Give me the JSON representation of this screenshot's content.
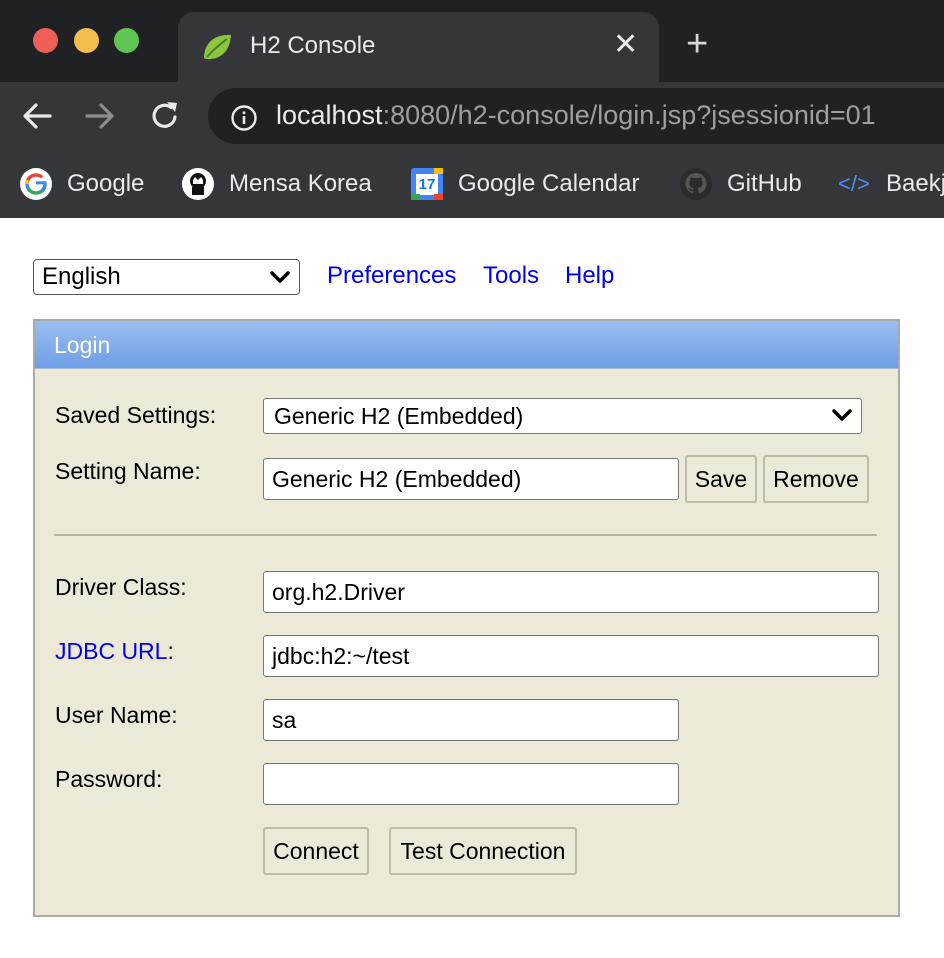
{
  "browser": {
    "tab_title": "H2 Console",
    "tab_close": "✕",
    "new_tab": "+",
    "url_host": "localhost",
    "url_rest": ":8080/h2-console/login.jsp?jsessionid=01",
    "bookmarks": [
      {
        "label": "Google"
      },
      {
        "label": "Mensa Korea"
      },
      {
        "label": "Google Calendar",
        "icon_text": "17"
      },
      {
        "label": "GitHub"
      },
      {
        "label": "Baekjoon",
        "icon_text": "</>"
      }
    ]
  },
  "top": {
    "language": "English",
    "links": [
      "Preferences",
      "Tools",
      "Help"
    ]
  },
  "login": {
    "title": "Login",
    "saved_settings_label": "Saved Settings:",
    "saved_settings_value": "Generic H2 (Embedded)",
    "setting_name_label": "Setting Name:",
    "setting_name_value": "Generic H2 (Embedded)",
    "save_button": "Save",
    "remove_button": "Remove",
    "driver_class_label": "Driver Class:",
    "driver_class_value": "org.h2.Driver",
    "jdbc_url_link": "JDBC URL",
    "jdbc_url_colon": ":",
    "jdbc_url_value": "jdbc:h2:~/test",
    "user_name_label": "User Name:",
    "user_name_value": "sa",
    "password_label": "Password:",
    "password_value": "",
    "connect_button": "Connect",
    "test_connection_button": "Test Connection"
  },
  "colors": {
    "chrome_dark": "#202124",
    "chrome_toolbar": "#35363a",
    "login_panel": "#ece9d8",
    "header_gradient_top": "#9abff1",
    "header_gradient_bottom": "#6f9ee6",
    "link": "#0000ee"
  }
}
